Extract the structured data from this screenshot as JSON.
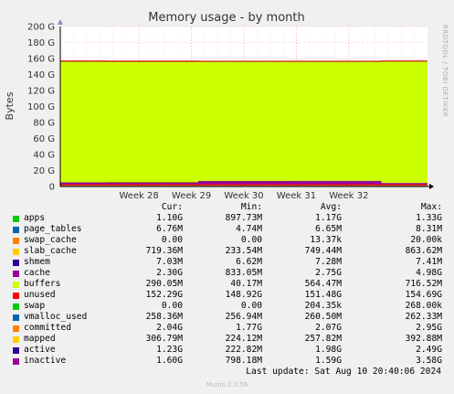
{
  "chart_data": {
    "type": "area",
    "title": "Memory usage - by month",
    "ylabel": "Bytes",
    "y_unit": "G",
    "ylim": [
      0,
      200
    ],
    "y_ticks": [
      "0",
      "20 G",
      "40 G",
      "60 G",
      "80 G",
      "100 G",
      "120 G",
      "140 G",
      "160 G",
      "180 G",
      "200 G"
    ],
    "y_tick_values": [
      0,
      20,
      40,
      60,
      80,
      100,
      120,
      140,
      160,
      180,
      200
    ],
    "x_ticks": [
      "Week 28",
      "Week 29",
      "Week 30",
      "Week 31",
      "Week 32"
    ],
    "x_tick_positions": [
      0.2143,
      0.3571,
      0.5,
      0.6429,
      0.7857
    ],
    "grid": true,
    "series": [
      {
        "name": "apps",
        "color": "#00cc00",
        "values_gb": [
          1.17,
          1.17,
          1.17,
          1.17,
          1.17
        ]
      },
      {
        "name": "page_tables",
        "color": "#0066b3",
        "values_gb": [
          0.0065,
          0.0065,
          0.0065,
          0.0065,
          0.0065
        ]
      },
      {
        "name": "swap_cache",
        "color": "#ff8000",
        "values_gb": [
          0,
          0,
          0,
          0,
          0
        ]
      },
      {
        "name": "slab_cache",
        "color": "#ffcc00",
        "values_gb": [
          0.75,
          0.75,
          0.75,
          0.75,
          0.72
        ]
      },
      {
        "name": "shmem",
        "color": "#330099",
        "values_gb": [
          0.0073,
          0.0073,
          0.0073,
          0.0073,
          0.007
        ]
      },
      {
        "name": "cache",
        "color": "#990099",
        "values_gb": [
          2.75,
          2.6,
          4.5,
          4.7,
          2.3
        ]
      },
      {
        "name": "buffers",
        "color": "#ccff00",
        "values_gb": [
          0.56,
          0.56,
          0.56,
          0.56,
          0.29
        ]
      },
      {
        "name": "unused",
        "color": "#ff0000",
        "values_gb": [
          151.48,
          151.5,
          149.5,
          149.3,
          152.29
        ]
      }
    ],
    "line_series": [
      {
        "name": "committed",
        "color": "#ff0000",
        "values_gb": [
          2.07,
          2.07,
          2.07,
          2.07,
          2.04
        ]
      },
      {
        "name": "vmalloc_used",
        "color": "#0066b3",
        "values_gb": [
          0.26,
          0.26,
          0.26,
          0.26,
          0.26
        ]
      },
      {
        "name": "mapped",
        "color": "#ff8000",
        "values_gb": [
          0.26,
          0.26,
          0.26,
          0.26,
          0.31
        ]
      }
    ]
  },
  "legend": {
    "headers": {
      "cur": "Cur:",
      "min": "Min:",
      "avg": "Avg:",
      "max": "Max:"
    },
    "rows": [
      {
        "name": "apps",
        "color": "#00cc00",
        "cur": "1.10G",
        "min": "897.73M",
        "avg": "1.17G",
        "max": "1.33G"
      },
      {
        "name": "page_tables",
        "color": "#0066b3",
        "cur": "6.76M",
        "min": "4.74M",
        "avg": "6.65M",
        "max": "8.31M"
      },
      {
        "name": "swap_cache",
        "color": "#ff8000",
        "cur": "0.00",
        "min": "0.00",
        "avg": "13.37k",
        "max": "20.00k"
      },
      {
        "name": "slab_cache",
        "color": "#ffcc00",
        "cur": "719.36M",
        "min": "233.54M",
        "avg": "749.44M",
        "max": "863.62M"
      },
      {
        "name": "shmem",
        "color": "#330099",
        "cur": "7.03M",
        "min": "6.62M",
        "avg": "7.28M",
        "max": "7.41M"
      },
      {
        "name": "cache",
        "color": "#990099",
        "cur": "2.30G",
        "min": "833.05M",
        "avg": "2.75G",
        "max": "4.98G"
      },
      {
        "name": "buffers",
        "color": "#ccff00",
        "cur": "290.05M",
        "min": "40.17M",
        "avg": "564.47M",
        "max": "716.52M"
      },
      {
        "name": "unused",
        "color": "#ff0000",
        "cur": "152.29G",
        "min": "148.92G",
        "avg": "151.48G",
        "max": "154.69G"
      },
      {
        "name": "swap",
        "color": "#00cc00",
        "cur": "0.00",
        "min": "0.00",
        "avg": "204.35k",
        "max": "268.00k"
      },
      {
        "name": "vmalloc_used",
        "color": "#0066b3",
        "cur": "258.36M",
        "min": "256.94M",
        "avg": "260.50M",
        "max": "262.33M"
      },
      {
        "name": "committed",
        "color": "#ff8000",
        "cur": "2.04G",
        "min": "1.77G",
        "avg": "2.07G",
        "max": "2.95G"
      },
      {
        "name": "mapped",
        "color": "#ffcc00",
        "cur": "306.79M",
        "min": "224.12M",
        "avg": "257.82M",
        "max": "392.88M"
      },
      {
        "name": "active",
        "color": "#330099",
        "cur": "1.23G",
        "min": "222.82M",
        "avg": "1.98G",
        "max": "2.49G"
      },
      {
        "name": "inactive",
        "color": "#990099",
        "cur": "1.60G",
        "min": "798.18M",
        "avg": "1.59G",
        "max": "3.58G"
      }
    ]
  },
  "last_update": "Last update: Sat Aug 10 20:40:06 2024",
  "side_label": "RRDTOOL / TOBI OETIKER",
  "munin_version": "Munin 2.0.56"
}
